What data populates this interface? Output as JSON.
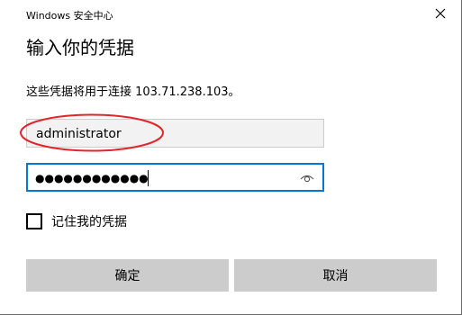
{
  "window": {
    "title": "Windows 安全中心",
    "close_icon": "close-icon"
  },
  "dialog": {
    "heading": "输入你的凭据",
    "description": "这些凭据将用于连接 103.71.238.103。"
  },
  "username": {
    "value": "administrator",
    "annotation_color": "#e0262b"
  },
  "password": {
    "masked_value": "●●●●●●●●●●●●",
    "focus_color": "#0078d7",
    "reveal_icon": "eye-icon"
  },
  "remember": {
    "label": "记住我的凭据",
    "checked": false
  },
  "buttons": {
    "ok_label": "确定",
    "cancel_label": "取消"
  }
}
